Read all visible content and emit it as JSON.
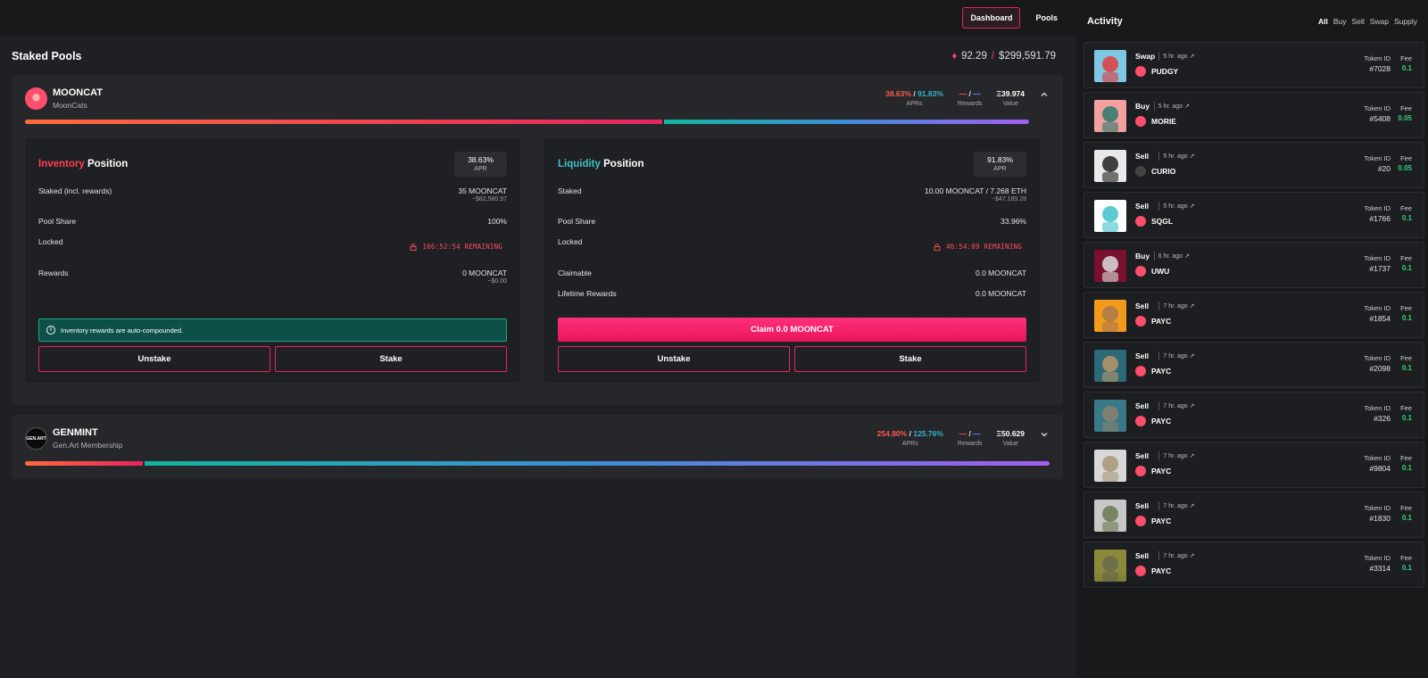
{
  "nav": {
    "dashboard": "Dashboard",
    "pools": "Pools"
  },
  "staked": {
    "title": "Staked Pools",
    "eth_total": "92.29",
    "separator": "/",
    "usd_total": "$299,591.79"
  },
  "labels": {
    "aprs": "APRs",
    "rewards": "Rewards",
    "value": "Value",
    "apr": "APR",
    "position": "Position"
  },
  "mooncat": {
    "name": "MOONCAT",
    "sub": "MoonCats",
    "apr_inventory": "38.63%",
    "apr_liquidity": "91.83%",
    "apr_sep": "/",
    "rewards_a": "—",
    "rewards_b": "—",
    "value": "Ξ39.974",
    "inventory_fraction": 0.635,
    "inventory": {
      "title_accent": "Inventory",
      "apr": "38.63%",
      "staked_label": "Staked (incl. rewards)",
      "staked_value": "35 MOONCAT",
      "staked_usd": "~$82,580.97",
      "share_label": "Pool Share",
      "share_value": "100%",
      "locked_label": "Locked",
      "locked_value": "166:52:54 REMAINING",
      "rewards_label": "Rewards",
      "rewards_value": "0 MOONCAT",
      "rewards_usd": "~$0.00",
      "info": "Inventory rewards are auto-compounded.",
      "unstake": "Unstake",
      "stake": "Stake"
    },
    "liquidity": {
      "title_accent": "Liquidity",
      "apr": "91.83%",
      "staked_label": "Staked",
      "staked_value": "10.00 MOONCAT / 7.268 ETH",
      "staked_usd": "~$47,189.28",
      "share_label": "Pool Share",
      "share_value": "33.96%",
      "locked_label": "Locked",
      "locked_value": "46:54:09 REMAINING",
      "claimable_label": "Claimable",
      "claimable_value": "0.0 MOONCAT",
      "lifetime_label": "Lifetime Rewards",
      "lifetime_value": "0.0 MOONCAT",
      "claim": "Claim 0.0 MOONCAT",
      "unstake": "Unstake",
      "stake": "Stake"
    }
  },
  "genmint": {
    "name": "GENMINT",
    "sub": "Gen.Art Membership",
    "logo": "GEN.ART",
    "apr_inventory": "254.80%",
    "apr_liquidity": "125.76%",
    "apr_sep": "/",
    "rewards_a": "—",
    "rewards_b": "—",
    "value": "Ξ50.629",
    "inventory_fraction": 0.115
  },
  "activity": {
    "title": "Activity",
    "filters": [
      "All",
      "Buy",
      "Sell",
      "Swap",
      "Supply"
    ],
    "token_id_label": "Token ID",
    "fee_label": "Fee",
    "items": [
      {
        "type": "Swap",
        "time": "5 hr. ago ↗",
        "collection": "PUDGY",
        "token": "#7028",
        "fee": "0.1",
        "thumb": "#7ec8e3",
        "accent": "#e23b3b"
      },
      {
        "type": "Buy",
        "time": "5 hr. ago ↗",
        "collection": "MORIE",
        "token": "#5408",
        "fee": "0.05",
        "thumb": "#f2a0a0",
        "accent": "#2a7a6a"
      },
      {
        "type": "Sell",
        "time": "5 hr. ago ↗",
        "collection": "CURIO",
        "token": "#20",
        "fee": "0.05",
        "thumb": "#e9e9e9",
        "accent": "#222222"
      },
      {
        "type": "Sell",
        "time": "5 hr. ago ↗",
        "collection": "SQGL",
        "token": "#1766",
        "fee": "0.1",
        "thumb": "#ffffff",
        "accent": "#3fc2c9"
      },
      {
        "type": "Buy",
        "time": "6 hr. ago ↗",
        "collection": "UWU",
        "token": "#1737",
        "fee": "0.1",
        "thumb": "#7a1030",
        "accent": "#dcdcdc"
      },
      {
        "type": "Sell",
        "time": "7 hr. ago ↗",
        "collection": "PAYC",
        "token": "#1854",
        "fee": "0.1",
        "thumb": "#f29a1c",
        "accent": "#a87a4a"
      },
      {
        "type": "Sell",
        "time": "7 hr. ago ↗",
        "collection": "PAYC",
        "token": "#2098",
        "fee": "0.1",
        "thumb": "#2c6a78",
        "accent": "#b89668"
      },
      {
        "type": "Sell",
        "time": "7 hr. ago ↗",
        "collection": "PAYC",
        "token": "#326",
        "fee": "0.1",
        "thumb": "#3a7a88",
        "accent": "#8a8070"
      },
      {
        "type": "Sell",
        "time": "7 hr. ago ↗",
        "collection": "PAYC",
        "token": "#9804",
        "fee": "0.1",
        "thumb": "#d8d8d8",
        "accent": "#a89878"
      },
      {
        "type": "Sell",
        "time": "7 hr. ago ↗",
        "collection": "PAYC",
        "token": "#1830",
        "fee": "0.1",
        "thumb": "#c8c8c8",
        "accent": "#6a7a50"
      },
      {
        "type": "Sell",
        "time": "7 hr. ago ↗",
        "collection": "PAYC",
        "token": "#3314",
        "fee": "0.1",
        "thumb": "#8a8a3a",
        "accent": "#6a6a4a"
      }
    ]
  }
}
